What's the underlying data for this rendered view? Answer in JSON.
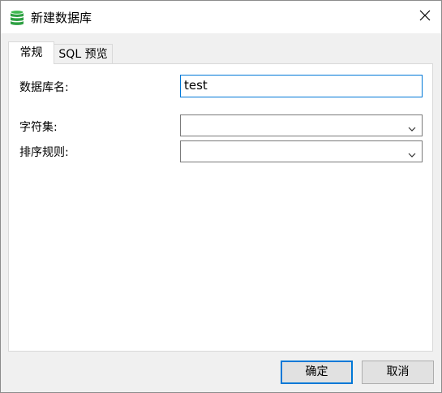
{
  "window": {
    "title": "新建数据库",
    "icon": "database-icon",
    "close_icon": "close-icon"
  },
  "tabs": [
    {
      "label": "常规",
      "active": true
    },
    {
      "label": "SQL 预览",
      "active": false
    }
  ],
  "form": {
    "db_name_label": "数据库名:",
    "db_name_value": "test",
    "charset_label": "字符集:",
    "charset_value": "",
    "collation_label": "排序规则:",
    "collation_value": ""
  },
  "buttons": {
    "ok": "确定",
    "cancel": "取消"
  },
  "colors": {
    "accent": "#0078d7",
    "icon_green": "#2ea043",
    "button_bg": "#e1e1e1"
  }
}
